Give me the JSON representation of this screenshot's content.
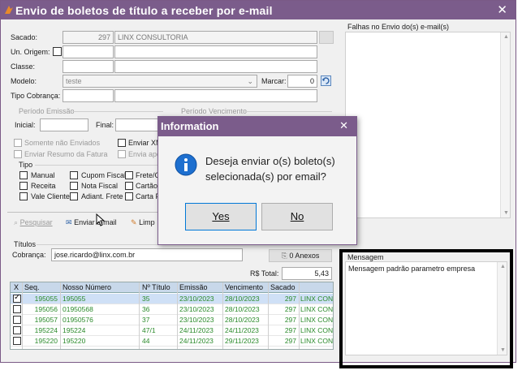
{
  "window": {
    "title": "Envio de boletos de título a receber por e-mail",
    "close_glyph": "✕",
    "accent": "#7b5c8b"
  },
  "form": {
    "sacado_label": "Sacado:",
    "sacado_code": "297",
    "sacado_name": "LINX CONSULTORIA",
    "un_origem_label": "Un. Origem:",
    "classe_label": "Classe:",
    "modelo_label": "Modelo:",
    "modelo_value": "teste",
    "marcar_label": "Marcar:",
    "marcar_value": "0",
    "tipo_cobranca_label": "Tipo Cobrança:"
  },
  "periodo_emissao": {
    "title": "Período Emissão",
    "inicial_label": "Inicial:",
    "final_label": "Final:"
  },
  "periodo_vencimento": {
    "title": "Período Vencimento"
  },
  "options": {
    "somente_nao_enviados": "Somente não Enviados",
    "enviar_xml": "Enviar XML",
    "enviar_resumo": "Enviar Resumo da Fatura",
    "envia_apenas": "Envia apen"
  },
  "tipo": {
    "title": "Tipo",
    "col1": [
      "Manual",
      "Receita",
      "Vale Cliente"
    ],
    "col2": [
      "Cupom Fiscal",
      "Nota Fiscal",
      "Adiant. Frete"
    ],
    "col3": [
      "Frete/C",
      "Cartão",
      "Carta F"
    ]
  },
  "toolbar": {
    "pesquisar": "Pesquisar",
    "enviar_email": "Enviar e-mail",
    "limpar": "Limp"
  },
  "titulos": {
    "title": "Títulos",
    "cobranca_label": "Cobrança:",
    "cobranca_value": "jose.ricardo@linx.com.br",
    "anexos_label": "0 Anexos",
    "total_label": "R$ Total:",
    "total_value": "5,43",
    "columns": [
      "X",
      "Seq.",
      "Nosso Número",
      "Nº Título",
      "Emissão",
      "Vencimento",
      "Sacado",
      ""
    ],
    "rows": [
      {
        "checked": true,
        "seq": "195055",
        "nosso": "195055",
        "titulo": "35",
        "emissao": "23/10/2023",
        "venc": "28/10/2023",
        "sacado": "297",
        "nome": "LINX CONS"
      },
      {
        "checked": false,
        "seq": "195056",
        "nosso": "01950568",
        "titulo": "36",
        "emissao": "23/10/2023",
        "venc": "28/10/2023",
        "sacado": "297",
        "nome": "LINX CONS"
      },
      {
        "checked": false,
        "seq": "195057",
        "nosso": "01950576",
        "titulo": "37",
        "emissao": "23/10/2023",
        "venc": "28/10/2023",
        "sacado": "297",
        "nome": "LINX CONS"
      },
      {
        "checked": false,
        "seq": "195224",
        "nosso": "195224",
        "titulo": "47/1",
        "emissao": "24/11/2023",
        "venc": "24/11/2023",
        "sacado": "297",
        "nome": "LINX CONS"
      },
      {
        "checked": false,
        "seq": "195220",
        "nosso": "195220",
        "titulo": "44",
        "emissao": "24/11/2023",
        "venc": "29/11/2023",
        "sacado": "297",
        "nome": "LINX CONS"
      }
    ]
  },
  "falhas": {
    "title": "Falhas no Envio do(s) e-mail(s)"
  },
  "mensagem": {
    "title": "Mensagem",
    "text": "Mensagem padrão parametro empresa"
  },
  "dialog": {
    "title": "Information",
    "close_glyph": "✕",
    "line1": "Deseja enviar o(s) boleto(s)",
    "line2": "selecionada(s) por email?",
    "yes": "Yes",
    "no": "No",
    "icon": "info-icon"
  }
}
